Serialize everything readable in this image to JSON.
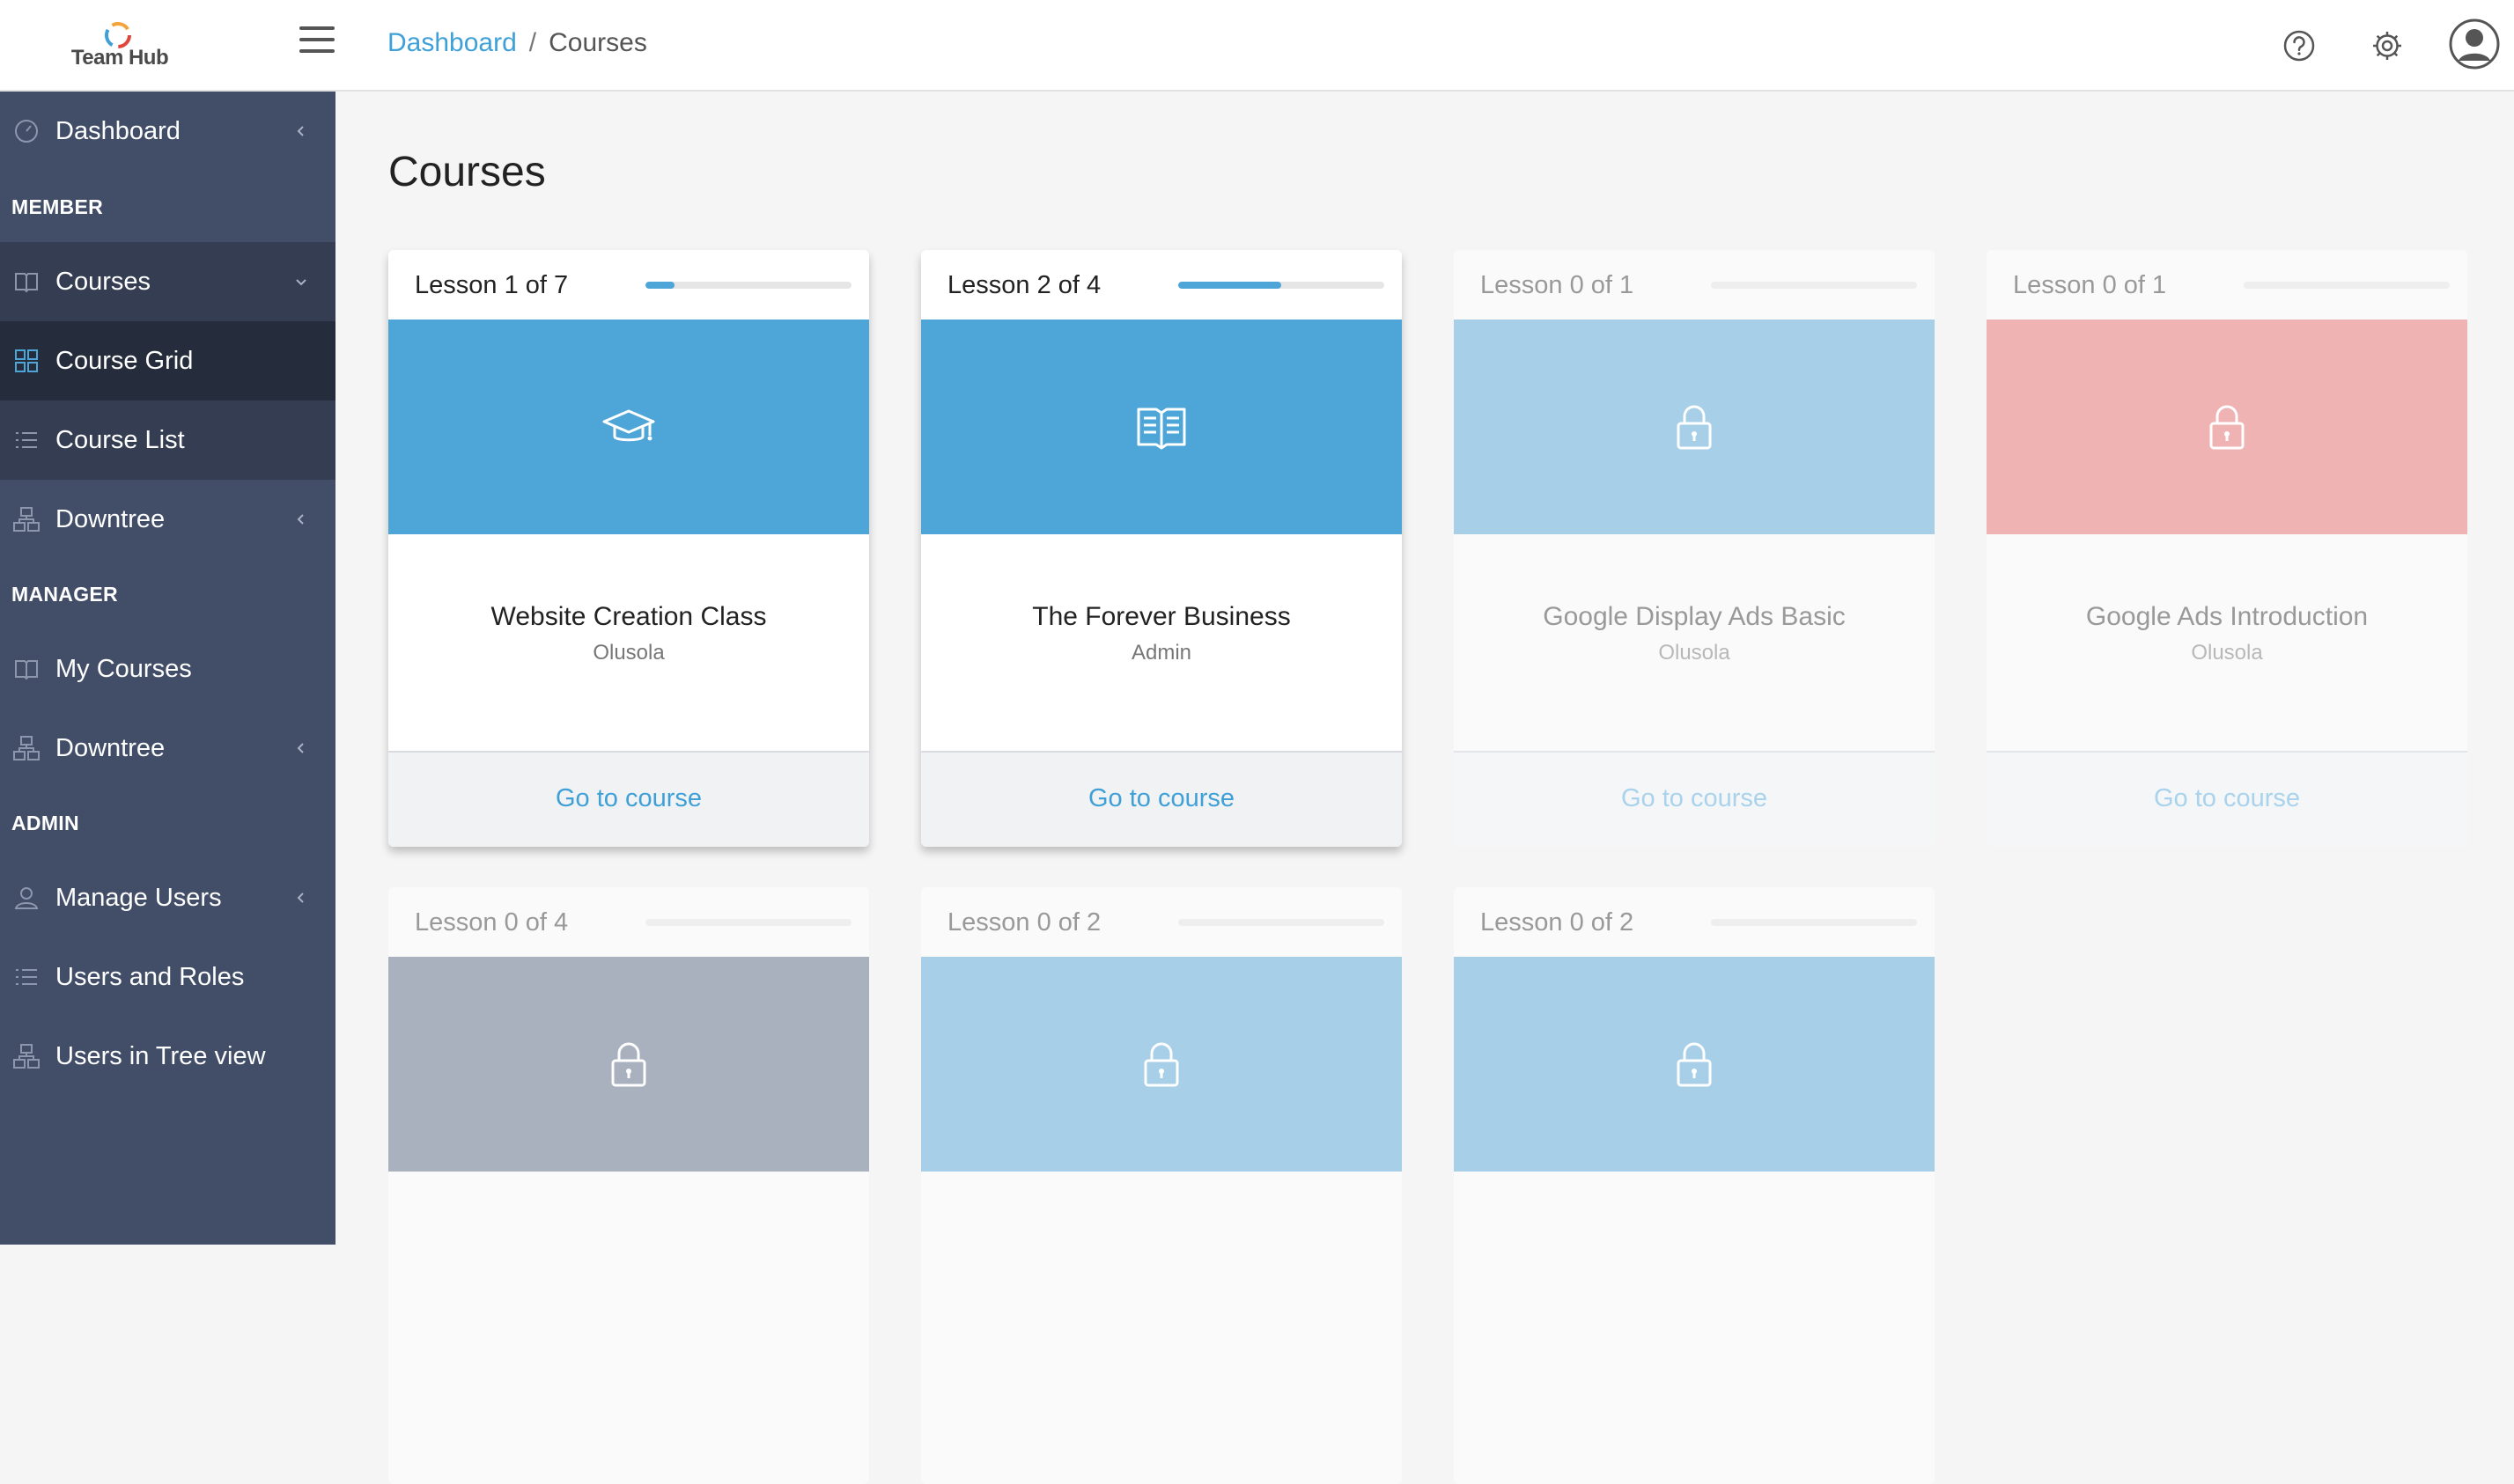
{
  "app": {
    "name": "Team Hub"
  },
  "breadcrumb": {
    "home": "Dashboard",
    "separator": "/",
    "current": "Courses"
  },
  "sidebar": {
    "items": [
      {
        "label": "Dashboard",
        "icon": "gauge-icon"
      },
      {
        "section": "MEMBER"
      },
      {
        "label": "Courses",
        "icon": "book-icon"
      },
      {
        "label": "Course Grid",
        "icon": "grid-icon"
      },
      {
        "label": "Course List",
        "icon": "list-icon"
      },
      {
        "label": "Downtree",
        "icon": "tree-icon"
      },
      {
        "section": "MANAGER"
      },
      {
        "label": "My Courses",
        "icon": "book-icon"
      },
      {
        "label": "Downtree",
        "icon": "tree-icon"
      },
      {
        "section": "ADMIN"
      },
      {
        "label": "Manage Users",
        "icon": "user-icon"
      },
      {
        "label": "Users and Roles",
        "icon": "list-icon"
      },
      {
        "label": "Users in Tree view",
        "icon": "tree-icon"
      }
    ]
  },
  "page": {
    "title": "Courses"
  },
  "courses": [
    {
      "lesson": "Lesson 1 of 7",
      "progress": 0.143,
      "title": "Website Creation Class",
      "author": "Olusola",
      "action": "Go to course",
      "color": "#4ea5d7",
      "icon": "graduation-cap-icon",
      "locked": false
    },
    {
      "lesson": "Lesson 2 of 4",
      "progress": 0.5,
      "title": "The Forever Business",
      "author": "Admin",
      "action": "Go to course",
      "color": "#4ea5d7",
      "icon": "open-book-icon",
      "locked": false
    },
    {
      "lesson": "Lesson 0 of 1",
      "progress": 0,
      "title": "Google Display Ads Basic",
      "author": "Olusola",
      "action": "Go to course",
      "color": "#a7cfe7",
      "icon": "lock-icon",
      "locked": true
    },
    {
      "lesson": "Lesson 0 of 1",
      "progress": 0,
      "title": "Google Ads Introduction",
      "author": "Olusola",
      "action": "Go to course",
      "color": "#f0b3b3",
      "icon": "lock-icon",
      "locked": true
    },
    {
      "lesson": "Lesson 0 of 4",
      "progress": 0,
      "color": "#a9b0be",
      "icon": "lock-icon",
      "locked": true
    },
    {
      "lesson": "Lesson 0 of 2",
      "progress": 0,
      "color": "#a7cfe7",
      "icon": "lock-icon",
      "locked": true
    },
    {
      "lesson": "Lesson 0 of 2",
      "progress": 0,
      "color": "#a7cfe7",
      "icon": "lock-icon",
      "locked": true
    }
  ]
}
